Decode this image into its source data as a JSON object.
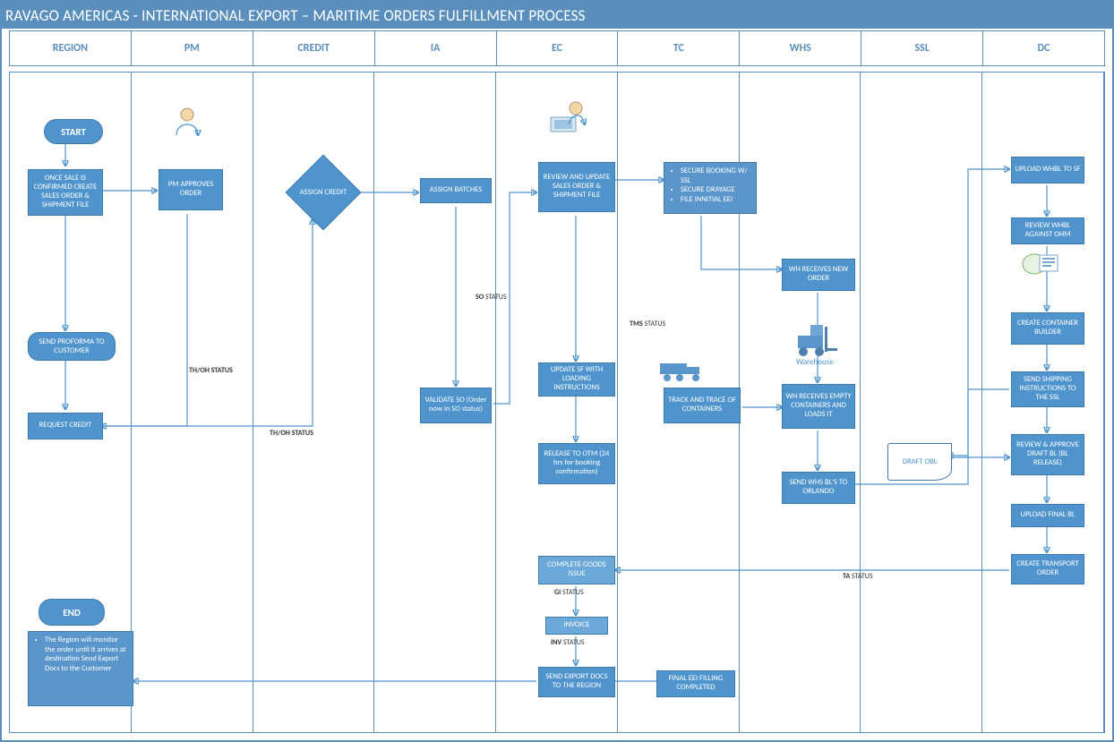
{
  "title": "RAVAGO AMERICAS - INTERNATIONAL EXPORT – MARITIME ORDERS FULFILLMENT PROCESS",
  "lanes": [
    "REGION",
    "PM",
    "CREDIT",
    "IA",
    "EC",
    "TC",
    "WHS",
    "SSL",
    "DC"
  ],
  "term": {
    "start": "START",
    "end": "END"
  },
  "boxes": {
    "r1": "ONCE SALE IS CONFIRMED CREATE SALES ORDER & SHIPMENT FILE",
    "r2": "SEND PROFORMA TO CUSTOMER",
    "r3": "REQUEST CREDIT",
    "r4": "The Region will monitor the order until it arrives at destination\nSend Export Docs to the Customer",
    "pm": "PM APPROVES ORDER",
    "cr": "ASSIGN CREDIT",
    "ia1": "ASSIGN BATCHES",
    "ia2": "VALIDATE SO\n(Order now in SO status)",
    "ec1": "REVIEW AND UPDATE SALES ORDER & SHIPMENT FILE",
    "ec2": "UPDATE SF WITH LOADING INSTRUCTIONS",
    "ec3": "RELEASE TO OTM\n(24 hrs for booking confirmation)",
    "ec4": "COMPLETE GOODS ISSUE",
    "ec5": "INVOICE",
    "ec6": "SEND EXPORT DOCS TO THE REGION",
    "tc1": "SECURE BOOKING W/ SSL\nSECURE DRAYAGE\nFILE INNITIAL EEI",
    "tc2": "TRACK AND TRACE OF CONTAINERS",
    "tc3": "FINAL EEI FILLING COMPLETED",
    "wh1": "WH RECEIVES NEW ORDER",
    "wh2": "WH RECEIVES EMPTY CONTAINERS AND LOADS IT",
    "wh3": "SEND WHS BL'S TO ORLANDO",
    "whlbl": "Warehouse",
    "ssl": "DRAFT OBL",
    "dc1": "UPLOAD WHBL TO SF",
    "dc2": "REVIEW WHBL AGAINST OHM",
    "dc3": "CREATE CONTAINER BUILDER",
    "dc4": "SEND SHIPPING INSTRUCTIONS TO THE SSL",
    "dc5": "REVIEW & APPROVE DRAFT BL\n(BL RELEASE)",
    "dc6": "UPLOAD FINAL BL",
    "dc7": "CREATE TRANSPORT ORDER"
  },
  "labels": {
    "thoh1": "TH/OH STATUS",
    "thoh2": "TH/OH STATUS",
    "so": "SO STATUS",
    "tms": "TMS STATUS",
    "gi": "GI STATUS",
    "inv": "INV STATUS",
    "ta": "TA STATUS"
  }
}
